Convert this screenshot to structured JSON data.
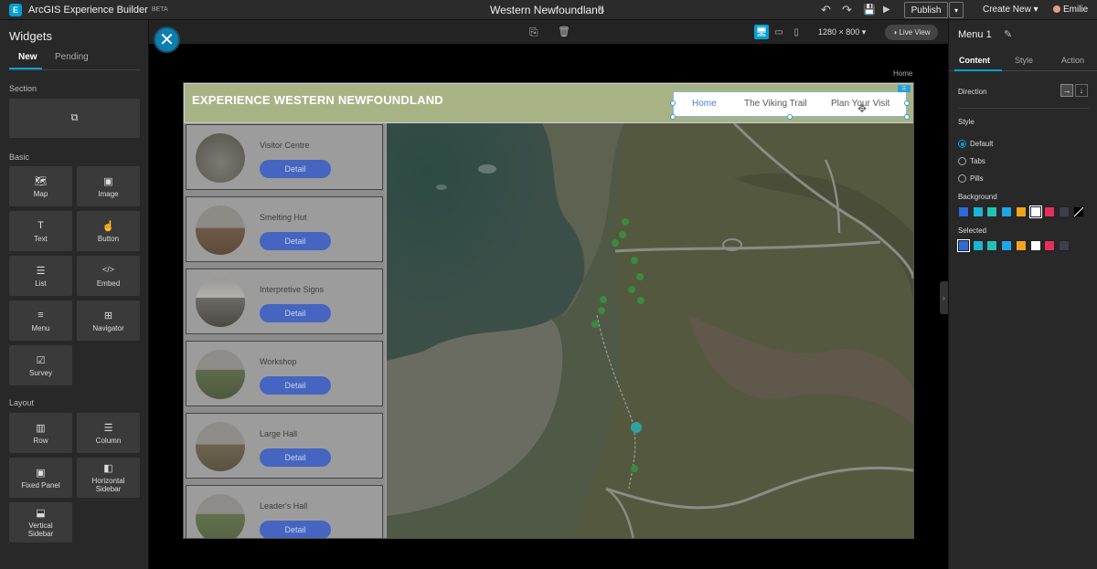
{
  "topbar": {
    "logo": "E",
    "app_title": "ArcGIS Experience Builder",
    "beta": "BETA",
    "doc_title": "Western Newfoundland",
    "edit_icon": "✎",
    "undo_icon": "↶",
    "redo_icon": "↷",
    "save_icon": "💾",
    "preview_icon": "▶",
    "publish_label": "Publish",
    "publish_caret": "▾",
    "create_new_label": "Create New ▾",
    "user_name": "Emilie"
  },
  "left_panel": {
    "title": "Widgets",
    "tabs": [
      "New",
      "Pending"
    ],
    "sections": {
      "section": "Section",
      "basic": "Basic",
      "layout": "Layout"
    },
    "section_icon": "⧉",
    "basic_widgets": [
      {
        "label": "Map",
        "icon": "🗺"
      },
      {
        "label": "Image",
        "icon": "▣"
      },
      {
        "label": "Text",
        "icon": "T"
      },
      {
        "label": "Button",
        "icon": "☝"
      },
      {
        "label": "List",
        "icon": "☰"
      },
      {
        "label": "Embed",
        "icon": "</>"
      },
      {
        "label": "Menu",
        "icon": "≡"
      },
      {
        "label": "Navigator",
        "icon": "⊞"
      },
      {
        "label": "Survey",
        "icon": "☑"
      }
    ],
    "layout_widgets": [
      {
        "label": "Row",
        "icon": "▥"
      },
      {
        "label": "Column",
        "icon": "☰"
      },
      {
        "label": "Fixed Panel",
        "icon": "▣"
      },
      {
        "label": "Horizontal Sidebar",
        "icon": "◧"
      },
      {
        "label": "Vertical Sidebar",
        "icon": "⬓"
      }
    ]
  },
  "canvas_toolbar": {
    "close_icon": "✕",
    "copy_icon": "⎘",
    "delete_icon": "🗑",
    "desktop_icon": "🖥",
    "tablet_icon": "▭",
    "phone_icon": "▯",
    "resolution": "1280 × 800 ▾",
    "live_view": "◑ Live View"
  },
  "page": {
    "breadcrumb": "Home",
    "site_title": "EXPERIENCE WESTERN NEWFOUNDLAND",
    "menu_items": [
      "Home",
      "The Viking Trail",
      "Plan Your Visit"
    ],
    "cards": [
      {
        "name": "Visitor Centre",
        "button": "Detail"
      },
      {
        "name": "Smelting Hut",
        "button": "Detail"
      },
      {
        "name": "Interpretive Signs",
        "button": "Detail"
      },
      {
        "name": "Workshop",
        "button": "Detail"
      },
      {
        "name": "Large Hall",
        "button": "Detail"
      },
      {
        "name": "Leader's Hall",
        "button": "Detail"
      }
    ]
  },
  "right_panel": {
    "title": "Menu 1",
    "edit_icon": "✎",
    "tabs": [
      "Content",
      "Style",
      "Action"
    ],
    "direction_label": "Direction",
    "direction_right": "→",
    "direction_down": "↓",
    "style_label": "Style",
    "style_options": [
      "Default",
      "Tabs",
      "Pills"
    ],
    "background_label": "Background",
    "selected_label": "Selected",
    "background_colors": [
      "#2e6ad8",
      "#19b6d8",
      "#24c2b5",
      "#1ea6ea",
      "#f2a41c",
      "#ffffff",
      "#e6305a",
      "#3a3f4a",
      "#000000"
    ],
    "selected_colors": [
      "#2e6ad8",
      "#19b6d8",
      "#24c2b5",
      "#1ea6ea",
      "#f2a41c",
      "#ffffff",
      "#e6305a",
      "#3a3f4a"
    ],
    "collapse_icon": "›"
  }
}
